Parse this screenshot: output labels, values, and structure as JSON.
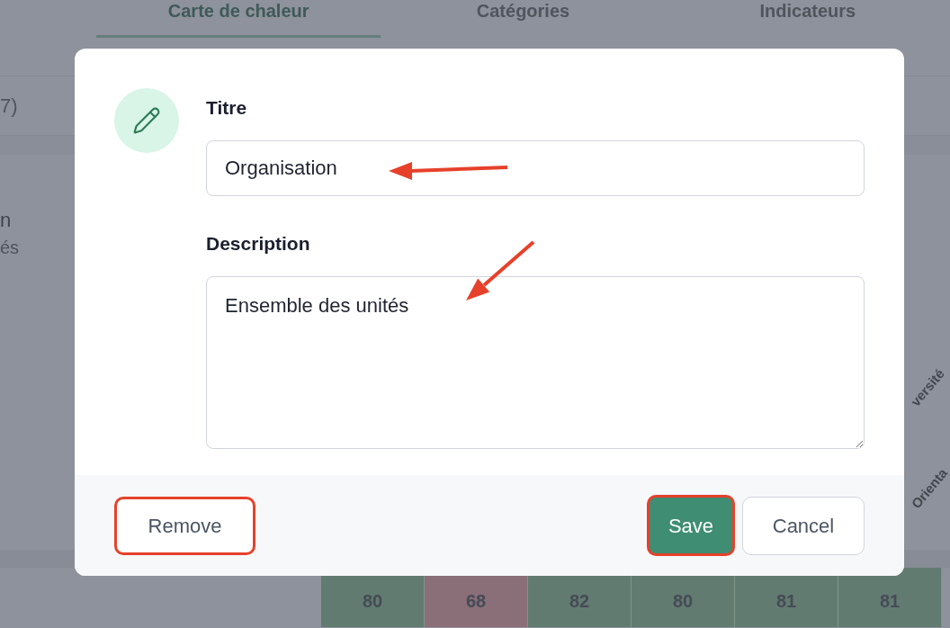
{
  "tabs": [
    {
      "label": "Carte de chaleur",
      "selected": true
    },
    {
      "label": "Catégories",
      "selected": false
    },
    {
      "label": "Indicateurs",
      "selected": false
    }
  ],
  "list_row": {
    "text": "7)"
  },
  "list_item": {
    "title": "n",
    "subtitle": "és"
  },
  "heatmap": {
    "column_headers": [
      "versité",
      "Orienta"
    ],
    "cells": [
      {
        "value": "80",
        "color": "#627b70"
      },
      {
        "value": "68",
        "color": "#8a6e78"
      },
      {
        "value": "82",
        "color": "#627b70"
      },
      {
        "value": "80",
        "color": "#627b70"
      },
      {
        "value": "81",
        "color": "#627b70"
      },
      {
        "value": "81",
        "color": "#627b70"
      }
    ]
  },
  "dialog": {
    "title_label": "Titre",
    "title_value": "Organisation",
    "description_label": "Description",
    "description_value": "Ensemble des unités",
    "buttons": [
      {
        "label": "Remove",
        "kind": "destructive",
        "highlighted": true
      },
      {
        "label": "Save",
        "kind": "primary",
        "highlighted": true
      },
      {
        "label": "Cancel",
        "kind": "default",
        "highlighted": false
      }
    ]
  }
}
